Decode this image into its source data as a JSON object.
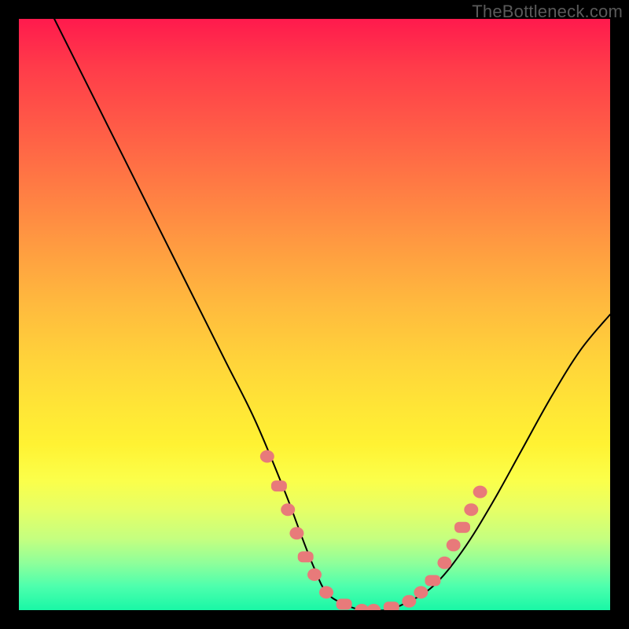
{
  "watermark": "TheBottleneck.com",
  "chart_data": {
    "type": "line",
    "title": "",
    "xlabel": "",
    "ylabel": "",
    "xlim": [
      0,
      100
    ],
    "ylim": [
      0,
      100
    ],
    "grid": false,
    "legend": false,
    "series": [
      {
        "name": "curve",
        "x": [
          6,
          10,
          15,
          20,
          25,
          30,
          35,
          40,
          45,
          48,
          50,
          52,
          55,
          58,
          60,
          62,
          65,
          70,
          75,
          80,
          85,
          90,
          95,
          100
        ],
        "y": [
          100,
          92,
          82,
          72,
          62,
          52,
          42,
          32,
          20,
          12,
          7,
          3,
          1,
          0,
          0,
          0,
          1,
          4,
          10,
          18,
          27,
          36,
          44,
          50
        ]
      }
    ],
    "markers": {
      "name": "highlight-band",
      "color": "#e87a7a",
      "points": [
        {
          "x": 42,
          "y": 26
        },
        {
          "x": 44,
          "y": 21
        },
        {
          "x": 45.5,
          "y": 17
        },
        {
          "x": 47,
          "y": 13
        },
        {
          "x": 48.5,
          "y": 9
        },
        {
          "x": 50,
          "y": 6
        },
        {
          "x": 52,
          "y": 3
        },
        {
          "x": 55,
          "y": 1
        },
        {
          "x": 58,
          "y": 0
        },
        {
          "x": 60,
          "y": 0
        },
        {
          "x": 63,
          "y": 0.5
        },
        {
          "x": 66,
          "y": 1.5
        },
        {
          "x": 68,
          "y": 3
        },
        {
          "x": 70,
          "y": 5
        },
        {
          "x": 72,
          "y": 8
        },
        {
          "x": 73.5,
          "y": 11
        },
        {
          "x": 75,
          "y": 14
        },
        {
          "x": 76.5,
          "y": 17
        },
        {
          "x": 78,
          "y": 20
        }
      ]
    },
    "gradient_stops": [
      {
        "pos": 0,
        "color": "#ff1a4d"
      },
      {
        "pos": 50,
        "color": "#ffd43a"
      },
      {
        "pos": 100,
        "color": "#19f7a6"
      }
    ]
  }
}
